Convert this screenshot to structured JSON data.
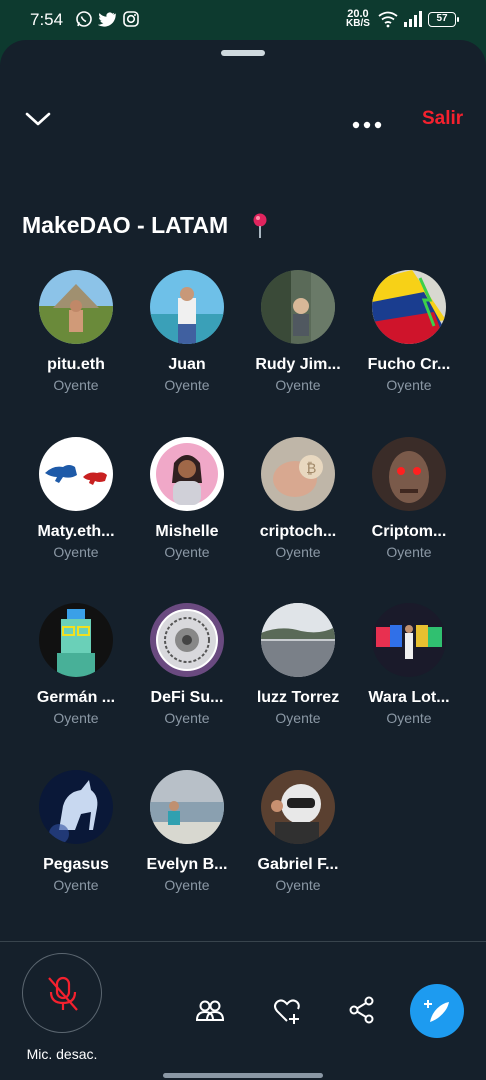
{
  "status_bar": {
    "time": "7:54",
    "net_speed_value": "20.0",
    "net_speed_unit": "KB/S",
    "battery": "57"
  },
  "header": {
    "exit_label": "Salir"
  },
  "space": {
    "title": "MakeDAO - LATAM"
  },
  "participants": [
    {
      "name": "pitu.eth",
      "role": "Oyente"
    },
    {
      "name": "Juan",
      "role": "Oyente"
    },
    {
      "name": "Rudy Jim...",
      "role": "Oyente"
    },
    {
      "name": "Fucho Cr...",
      "role": "Oyente"
    },
    {
      "name": "Maty.eth...",
      "role": "Oyente"
    },
    {
      "name": "Mishelle",
      "role": "Oyente"
    },
    {
      "name": "criptoch...",
      "role": "Oyente"
    },
    {
      "name": "Criptom...",
      "role": "Oyente"
    },
    {
      "name": "Germán ...",
      "role": "Oyente"
    },
    {
      "name": "DeFi Su...",
      "role": "Oyente"
    },
    {
      "name": "luzz Torrez",
      "role": "Oyente"
    },
    {
      "name": "Wara Lot...",
      "role": "Oyente"
    },
    {
      "name": "Pegasus",
      "role": "Oyente"
    },
    {
      "name": "Evelyn B...",
      "role": "Oyente"
    },
    {
      "name": "Gabriel F...",
      "role": "Oyente"
    }
  ],
  "bottom_bar": {
    "mic_label": "Mic. desac."
  },
  "colors": {
    "background": "#15202b",
    "status_bar": "#0d3a2f",
    "accent": "#1d9bf0",
    "danger": "#f4212e",
    "secondary_text": "#8b98a5"
  }
}
